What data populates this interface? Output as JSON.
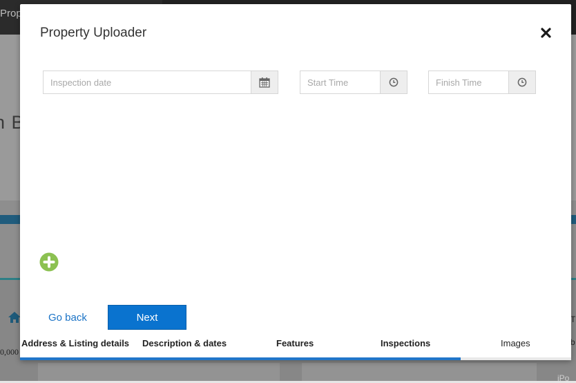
{
  "background": {
    "tab_text": "Prop",
    "heading_fragment": "n B",
    "price_fragment": "0,000",
    "right_text_a": "T",
    "right_text_b": "b",
    "right_text_c": "iPo"
  },
  "modal": {
    "title": "Property Uploader",
    "fields": {
      "inspection_date": {
        "placeholder": "Inspection date",
        "icon": "calendar-icon"
      },
      "start_time": {
        "placeholder": "Start Time",
        "icon": "clock-icon"
      },
      "finish_time": {
        "placeholder": "Finish Time",
        "icon": "clock-icon"
      }
    },
    "add_icon": "plus-circle-icon",
    "go_back_label": "Go back",
    "next_label": "Next",
    "steps": [
      {
        "label": "Address & Listing details",
        "status": "done"
      },
      {
        "label": "Description & dates",
        "status": "done"
      },
      {
        "label": "Features",
        "status": "done"
      },
      {
        "label": "Inspections",
        "status": "current"
      },
      {
        "label": "Images",
        "status": "pending"
      }
    ],
    "progress": 0.8
  },
  "colors": {
    "accent": "#0a73cf",
    "add_button": "#8cc152",
    "progress": "#2176c9"
  }
}
